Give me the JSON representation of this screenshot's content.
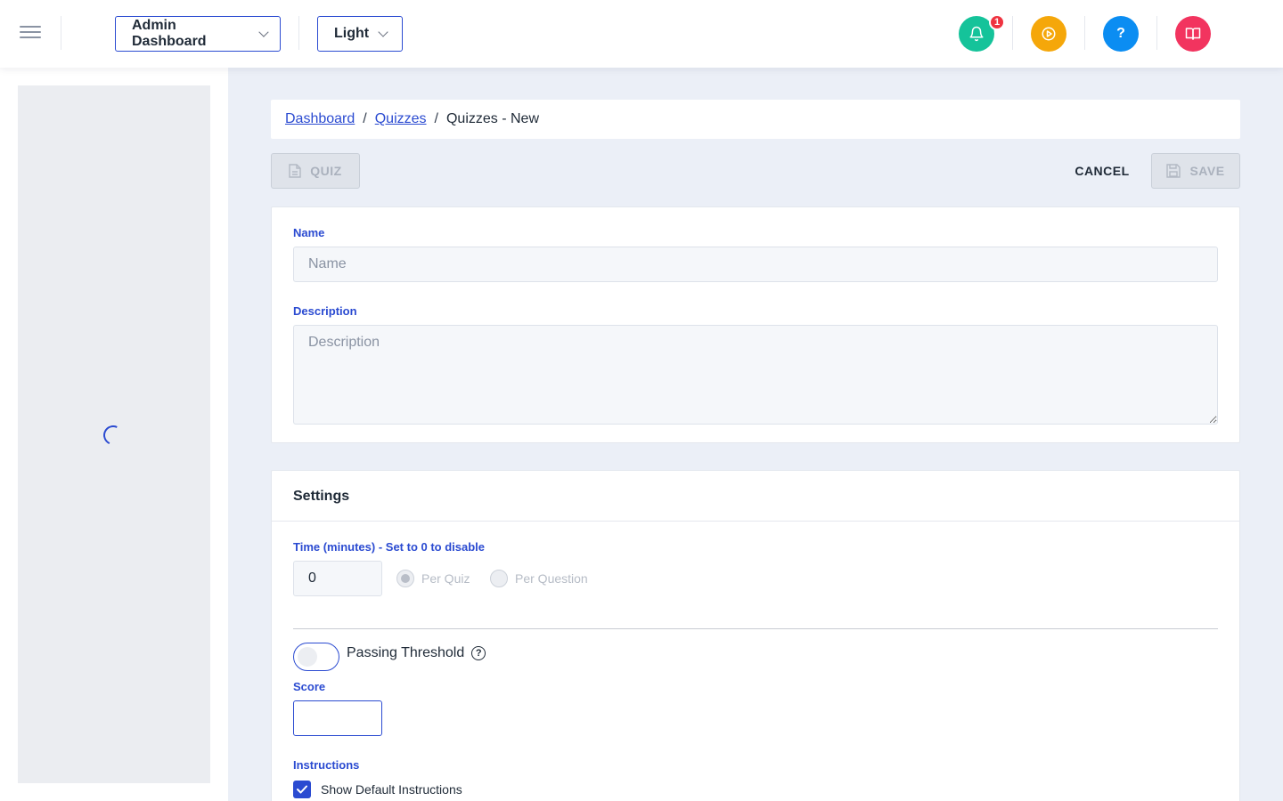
{
  "header": {
    "dashboard_select": "Admin Dashboard",
    "theme_select": "Light",
    "notification_count": "1",
    "colors": {
      "bell": "#15c39a",
      "play": "#f5a70a",
      "help": "#0b8df2",
      "book": "#f2345f"
    }
  },
  "breadcrumb": {
    "items": [
      "Dashboard",
      "Quizzes"
    ],
    "separator": "/",
    "current": "Quizzes - New"
  },
  "toolbar": {
    "quiz_label": "QUIZ",
    "cancel_label": "CANCEL",
    "save_label": "SAVE"
  },
  "details": {
    "name_label": "Name",
    "name_placeholder": "Name",
    "description_label": "Description",
    "description_placeholder": "Description"
  },
  "settings": {
    "title": "Settings",
    "time_label": "Time (minutes) - Set to 0 to disable",
    "time_value": "0",
    "per_quiz_label": "Per Quiz",
    "per_question_label": "Per Question",
    "passing_threshold_label": "Passing Threshold",
    "help_glyph": "?",
    "score_label": "Score",
    "score_value": "",
    "instructions_label": "Instructions",
    "show_default_instructions_label": "Show Default Instructions"
  },
  "accent_color": "#2b4bd1"
}
